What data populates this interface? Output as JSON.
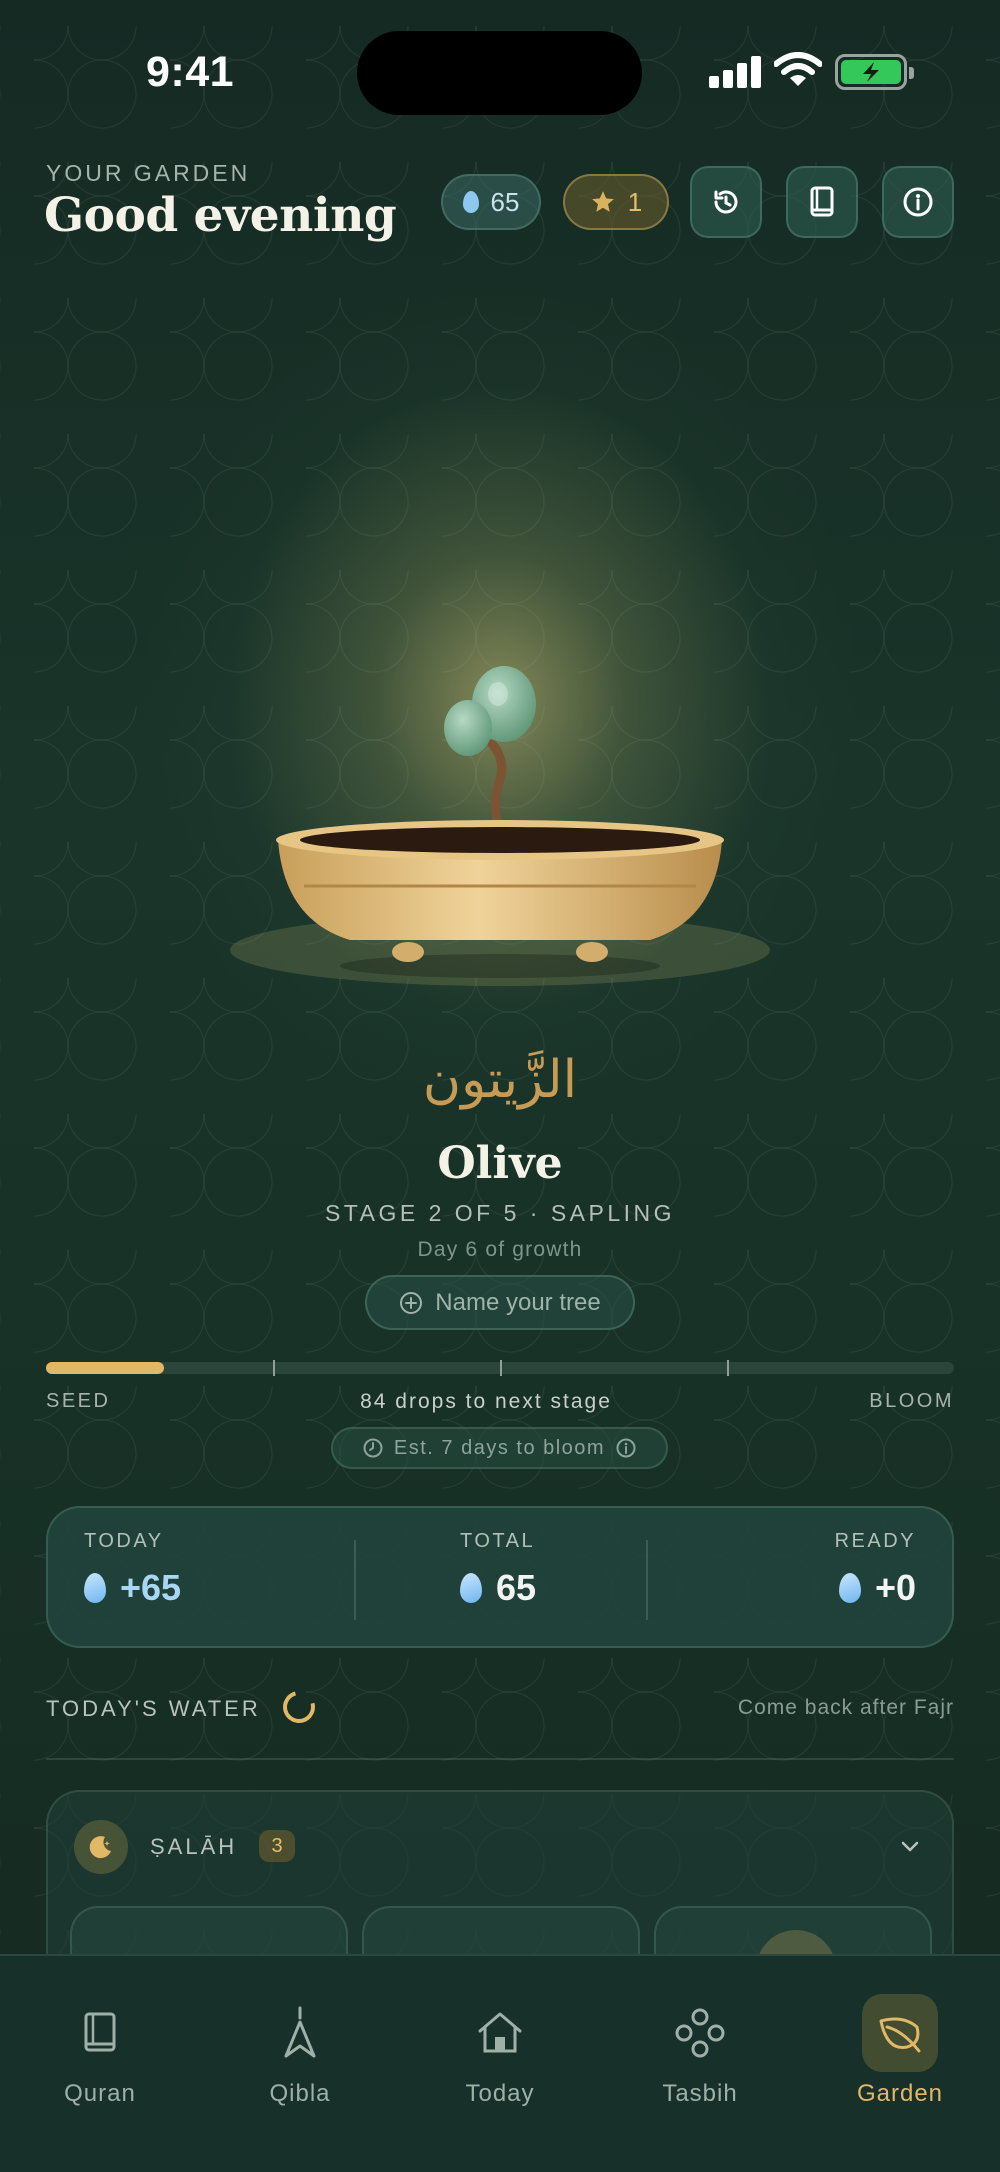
{
  "status_bar": {
    "time": "9:41"
  },
  "header": {
    "eyebrow": "YOUR GARDEN",
    "greeting": "Good evening",
    "drops_count": "65",
    "stars_count": "1",
    "icons": [
      "drop-icon",
      "star-icon",
      "history-icon",
      "book-icon",
      "info-icon"
    ]
  },
  "tree": {
    "arabic_name": "الزَّيتون",
    "name": "Olive",
    "stage": "STAGE 2 OF 5 · SAPLING",
    "day": "Day 6 of growth",
    "name_button": "Name your tree"
  },
  "progress": {
    "fill_fraction": 0.13,
    "stage_markers": 4,
    "start_label": "SEED",
    "middle_label": "84 drops to next stage",
    "end_label": "BLOOM",
    "estimate": "Est. 7 days to bloom"
  },
  "stats": {
    "today_label": "TODAY",
    "today_value": "+65",
    "total_label": "TOTAL",
    "total_value": "65",
    "ready_label": "READY",
    "ready_value": "+0"
  },
  "water": {
    "title": "TODAY'S WATER",
    "note": "Come back after Fajr"
  },
  "salah": {
    "label": "ṢALĀH",
    "count": "3"
  },
  "tabs": [
    {
      "label": "Quran",
      "icon": "book-icon",
      "active": false
    },
    {
      "label": "Qibla",
      "icon": "compass-icon",
      "active": false
    },
    {
      "label": "Today",
      "icon": "home-icon",
      "active": false
    },
    {
      "label": "Tasbih",
      "icon": "beads-icon",
      "active": false
    },
    {
      "label": "Garden",
      "icon": "leaf-icon",
      "active": true
    }
  ],
  "colors": {
    "background": "#14281f",
    "accent_gold": "#e0b866",
    "drop_blue": "#8cc8f0",
    "battery_green": "#34c759"
  }
}
